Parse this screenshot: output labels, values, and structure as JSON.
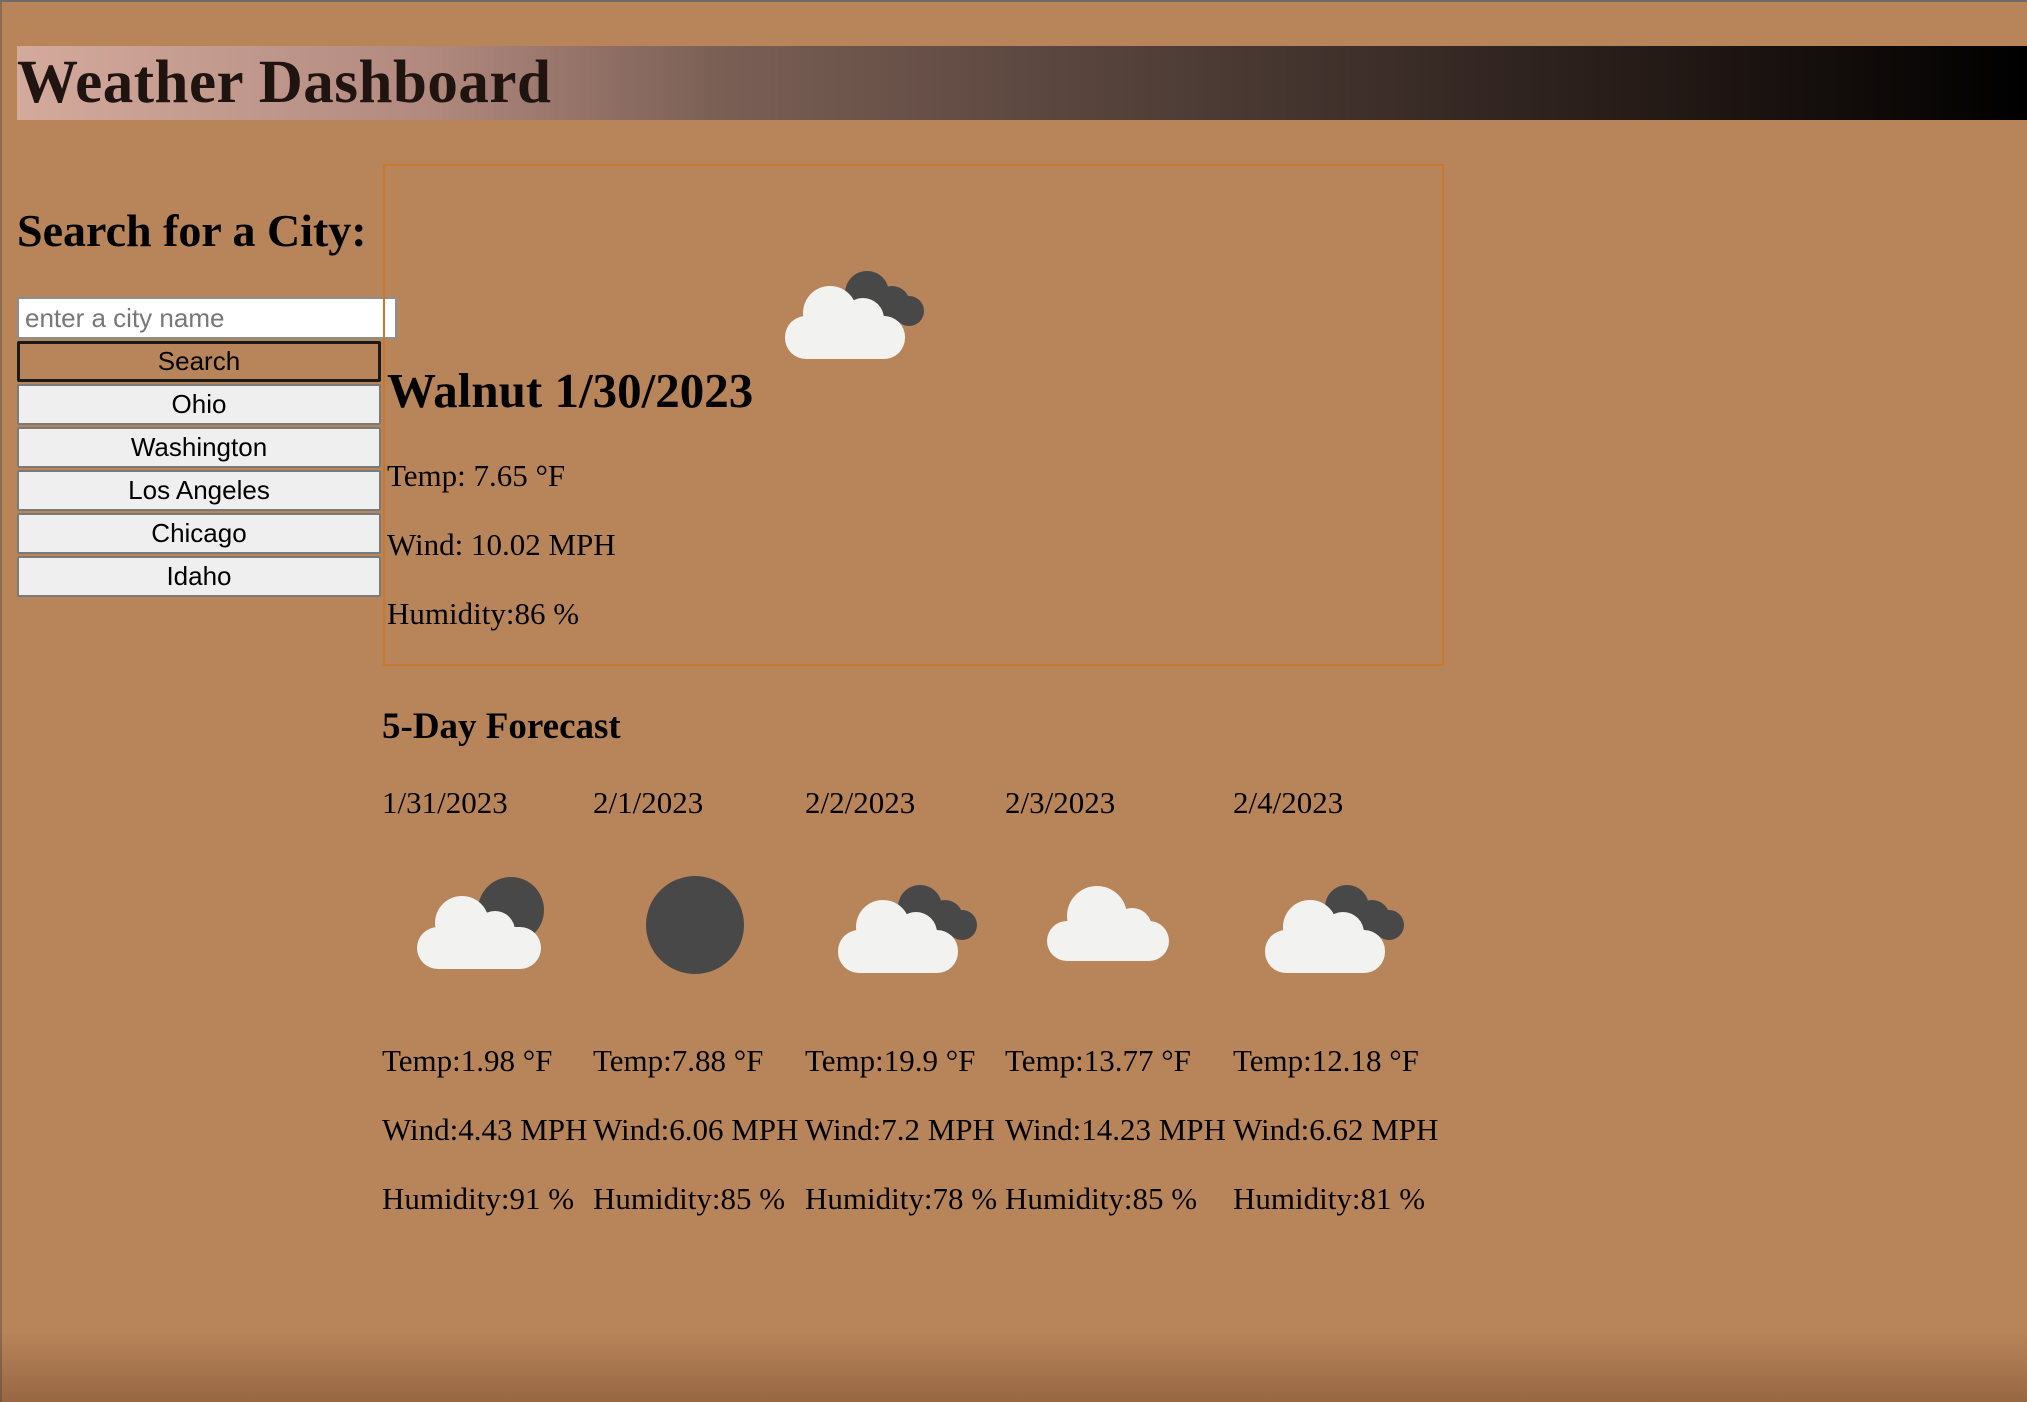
{
  "app": {
    "title": "Weather Dashboard"
  },
  "sidebar": {
    "heading": "Search for a City:",
    "search_placeholder": "enter a city name",
    "search_value": "",
    "search_button": "Search",
    "history": [
      "Ohio",
      "Washington",
      "Los Angeles",
      "Chicago",
      "Idaho"
    ]
  },
  "current": {
    "title": "Walnut 1/30/2023",
    "icon": "partly-cloudy-night-icon",
    "temp": "Temp: 7.65 °F",
    "wind": "Wind: 10.02 MPH",
    "humidity": "Humidity:86 %"
  },
  "forecast": {
    "heading": "5-Day Forecast",
    "days": [
      {
        "date": "1/31/2023",
        "icon": "cloud-moon-icon",
        "temp": "Temp:1.98 °F",
        "wind": "Wind:4.43 MPH",
        "humidity": "Humidity:91 %"
      },
      {
        "date": "2/1/2023",
        "icon": "moon-icon",
        "temp": "Temp:7.88 °F",
        "wind": "Wind:6.06 MPH",
        "humidity": "Humidity:85 %"
      },
      {
        "date": "2/2/2023",
        "icon": "partly-cloudy-night-icon",
        "temp": "Temp:19.9 °F",
        "wind": "Wind:7.2 MPH",
        "humidity": "Humidity:78 %"
      },
      {
        "date": "2/3/2023",
        "icon": "cloud-icon",
        "temp": "Temp:13.77 °F",
        "wind": "Wind:14.23 MPH",
        "humidity": "Humidity:85 %"
      },
      {
        "date": "2/4/2023",
        "icon": "partly-cloudy-night-icon",
        "temp": "Temp:12.18 °F",
        "wind": "Wind:6.62 MPH",
        "humidity": "Humidity:81 %"
      }
    ]
  },
  "colors": {
    "background": "#b8845a",
    "card_border": "#c9782f",
    "cloud_white": "#f2f2f0",
    "dark_cloud": "#484848",
    "header_gradient_start": "#d3aa9c",
    "header_gradient_end": "#000000"
  }
}
